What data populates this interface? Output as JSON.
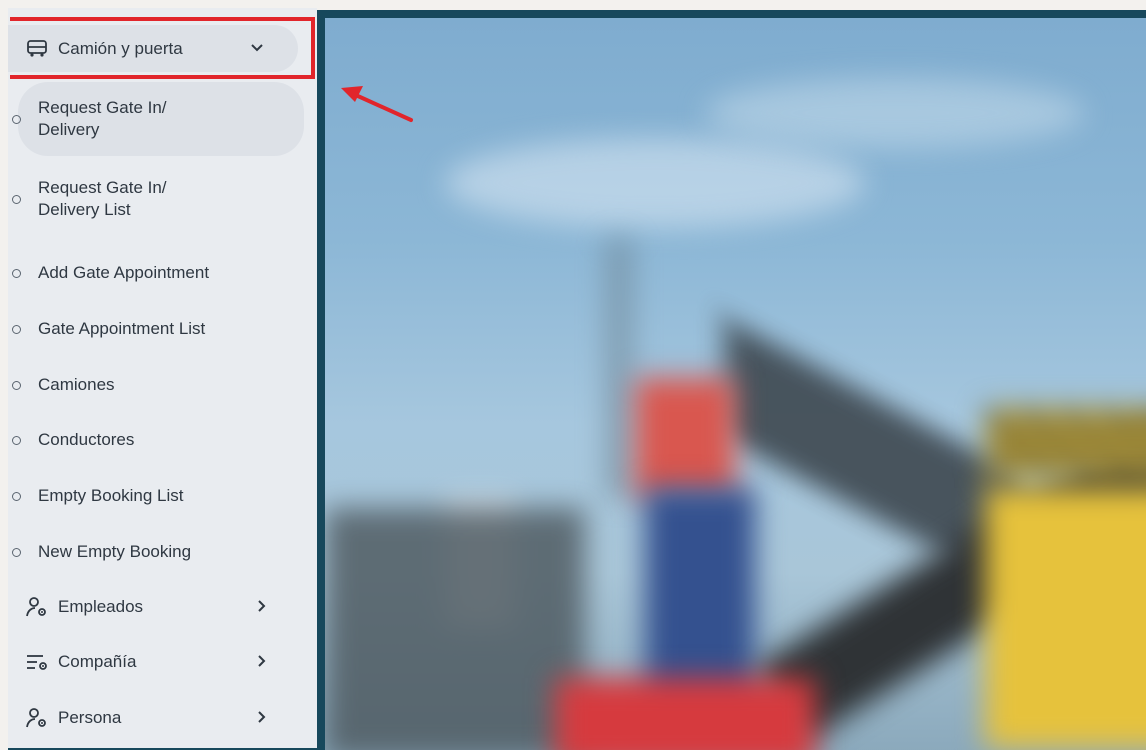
{
  "sidebar": {
    "group": {
      "label": "Camión y puerta",
      "icon": "truck-icon",
      "expanded": true
    },
    "items": [
      {
        "label_line1": "Request Gate In/",
        "label_line2": "Delivery",
        "active": true
      },
      {
        "label_line1": "Request Gate In/",
        "label_line2": "Delivery List"
      },
      {
        "label": "Add Gate Appointment"
      },
      {
        "label": "Gate Appointment List"
      },
      {
        "label": "Camiones"
      },
      {
        "label": "Conductores"
      },
      {
        "label": "Empty Booking List"
      },
      {
        "label": "New Empty Booking"
      }
    ],
    "sections": [
      {
        "label": "Empleados",
        "icon": "user-gear-icon"
      },
      {
        "label": "Compañía",
        "icon": "list-gear-icon"
      },
      {
        "label": "Persona",
        "icon": "user-gear-icon"
      }
    ]
  },
  "colors": {
    "frame": "#17485c",
    "sidebar_bg": "#e9ecf0",
    "highlight": "#e1252b",
    "text": "#2f3842"
  }
}
